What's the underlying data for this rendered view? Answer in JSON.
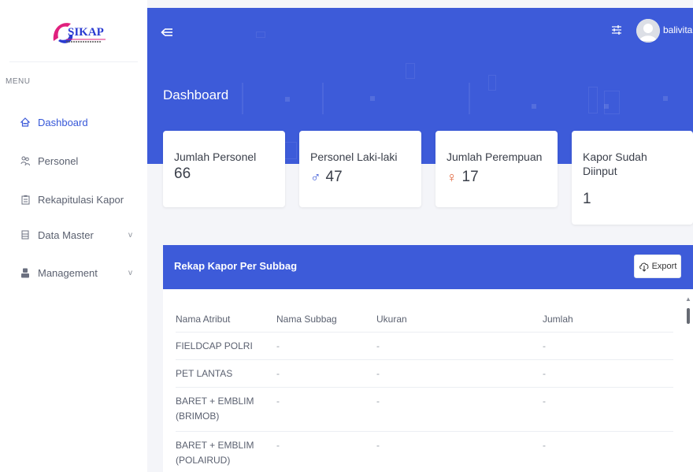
{
  "app": {
    "logo_text": "SIKAP"
  },
  "sidebar": {
    "menu_label": "MENU",
    "items": [
      {
        "label": "Dashboard",
        "icon": "home-icon",
        "active": true,
        "caret": ""
      },
      {
        "label": "Personel",
        "icon": "users-icon",
        "active": false,
        "caret": ""
      },
      {
        "label": "Rekapitulasi Kapor",
        "icon": "clipboard-icon",
        "active": false,
        "caret": ""
      },
      {
        "label": "Data Master",
        "icon": "document-icon",
        "active": false,
        "caret": "v"
      },
      {
        "label": "Management",
        "icon": "user-icon",
        "active": false,
        "caret": "v"
      }
    ]
  },
  "header": {
    "user_name": "balivita",
    "page_title": "Dashboard"
  },
  "stats": [
    {
      "label": "Jumlah Personel",
      "value": "66",
      "symbol": ""
    },
    {
      "label": "Personel Laki-laki",
      "value": "47",
      "symbol": "♂",
      "symbol_color": "#3d5bd9"
    },
    {
      "label": "Jumlah Perempuan",
      "value": "17",
      "symbol": "♀",
      "symbol_color": "#e0643a"
    },
    {
      "label": "Kapor Sudah Diinput",
      "value": "1",
      "symbol": ""
    }
  ],
  "rekap": {
    "title": "Rekap Kapor Per Subbag",
    "export_label": "Export",
    "columns": [
      "Nama Atribut",
      "Nama Subbag",
      "Ukuran",
      "Jumlah"
    ],
    "rows": [
      [
        "FIELDCAP POLRI",
        "-",
        "-",
        "-"
      ],
      [
        "PET LANTAS",
        "-",
        "-",
        "-"
      ],
      [
        "BARET + EMBLIM (BRIMOB)",
        "-",
        "-",
        "-"
      ],
      [
        "BARET + EMBLIM (POLAIRUD)",
        "-",
        "-",
        "-"
      ]
    ]
  },
  "colors": {
    "primary": "#3d5bd9",
    "background": "#f4f5f9"
  }
}
